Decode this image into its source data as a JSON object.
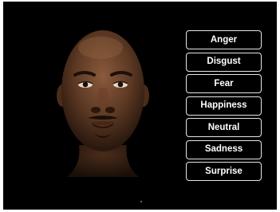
{
  "stimulus": {
    "image": "face-3d-avatar",
    "background_color": "#000000"
  },
  "emotion_options": {
    "items": [
      {
        "label": "Anger"
      },
      {
        "label": "Disgust"
      },
      {
        "label": "Fear"
      },
      {
        "label": "Happiness"
      },
      {
        "label": "Neutral"
      },
      {
        "label": "Sadness"
      },
      {
        "label": "Surprise"
      }
    ],
    "border_color": "#e6e6e6",
    "text_color": "#ffffff"
  }
}
